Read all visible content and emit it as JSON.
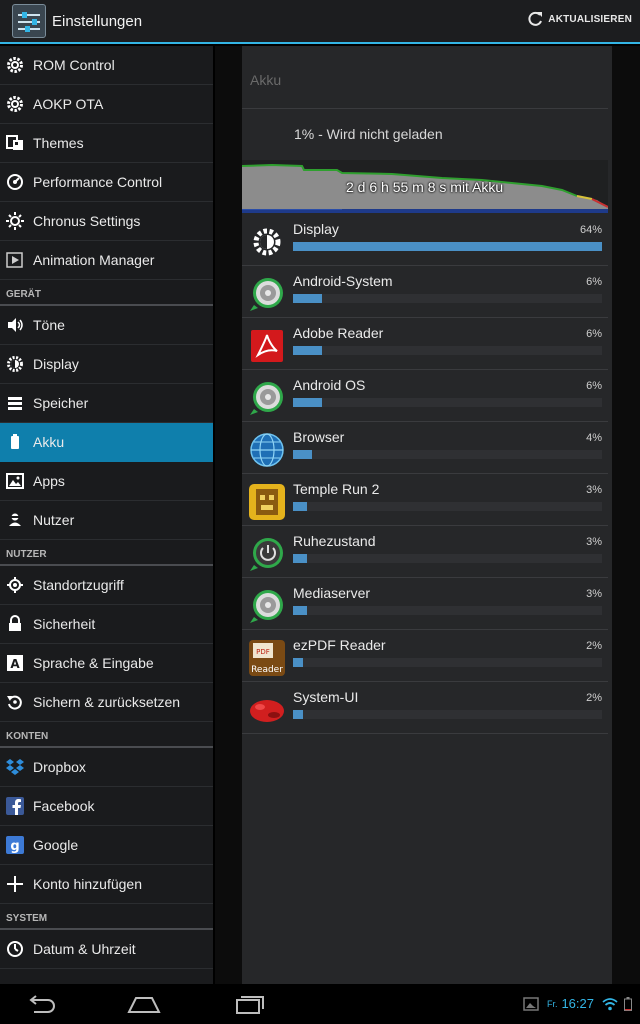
{
  "actionbar": {
    "title": "Einstellungen",
    "refresh_label": "AKTUALISIEREN"
  },
  "sidebar": {
    "items": [
      {
        "label": "ROM Control",
        "icon": "gear-icon"
      },
      {
        "label": "AOKP OTA",
        "icon": "gear-icon"
      },
      {
        "label": "Themes",
        "icon": "themes-icon"
      },
      {
        "label": "Performance Control",
        "icon": "performance-icon"
      },
      {
        "label": "Chronus Settings",
        "icon": "sun-icon"
      },
      {
        "label": "Animation Manager",
        "icon": "animation-icon"
      },
      {
        "section": "GERÄT"
      },
      {
        "label": "Töne",
        "icon": "speaker-icon"
      },
      {
        "label": "Display",
        "icon": "brightness-icon"
      },
      {
        "label": "Speicher",
        "icon": "storage-icon"
      },
      {
        "label": "Akku",
        "icon": "battery-icon",
        "active": true
      },
      {
        "label": "Apps",
        "icon": "apps-icon"
      },
      {
        "label": "Nutzer",
        "icon": "user-icon"
      },
      {
        "section": "NUTZER"
      },
      {
        "label": "Standortzugriff",
        "icon": "location-icon"
      },
      {
        "label": "Sicherheit",
        "icon": "lock-icon"
      },
      {
        "label": "Sprache & Eingabe",
        "icon": "language-icon"
      },
      {
        "label": "Sichern & zurücksetzen",
        "icon": "backup-icon"
      },
      {
        "section": "KONTEN"
      },
      {
        "label": "Dropbox",
        "icon": "dropbox-icon"
      },
      {
        "label": "Facebook",
        "icon": "facebook-icon"
      },
      {
        "label": "Google",
        "icon": "google-icon"
      },
      {
        "label": "Konto hinzufügen",
        "icon": "plus-icon"
      },
      {
        "section": "SYSTEM"
      },
      {
        "label": "Datum & Uhrzeit",
        "icon": "clock-icon"
      }
    ]
  },
  "battery": {
    "title": "Akku",
    "status": "1% - Wird nicht geladen",
    "graph_label": "2 d 6 h 55 m 8 s mit Akku",
    "apps": [
      {
        "name": "Display",
        "percent": "64%",
        "value": 64,
        "icon": "display-brightness-icon"
      },
      {
        "name": "Android-System",
        "percent": "6%",
        "value": 6,
        "icon": "android-system-icon"
      },
      {
        "name": "Adobe Reader",
        "percent": "6%",
        "value": 6,
        "icon": "adobe-reader-icon"
      },
      {
        "name": "Android OS",
        "percent": "6%",
        "value": 6,
        "icon": "android-os-icon"
      },
      {
        "name": "Browser",
        "percent": "4%",
        "value": 4,
        "icon": "browser-globe-icon"
      },
      {
        "name": "Temple Run 2",
        "percent": "3%",
        "value": 3,
        "icon": "temple-run-icon"
      },
      {
        "name": "Ruhezustand",
        "percent": "3%",
        "value": 3,
        "icon": "power-icon"
      },
      {
        "name": "Mediaserver",
        "percent": "3%",
        "value": 3,
        "icon": "mediaserver-icon"
      },
      {
        "name": "ezPDF Reader",
        "percent": "2%",
        "value": 2,
        "icon": "ezpdf-icon"
      },
      {
        "name": "System-UI",
        "percent": "2%",
        "value": 2,
        "icon": "system-ui-icon"
      }
    ]
  },
  "statusbar": {
    "day": "Fr.",
    "time": "16:27"
  },
  "colors": {
    "accent": "#33b5e5",
    "active_item": "#0f7fac",
    "bar": "#4a90c6"
  }
}
